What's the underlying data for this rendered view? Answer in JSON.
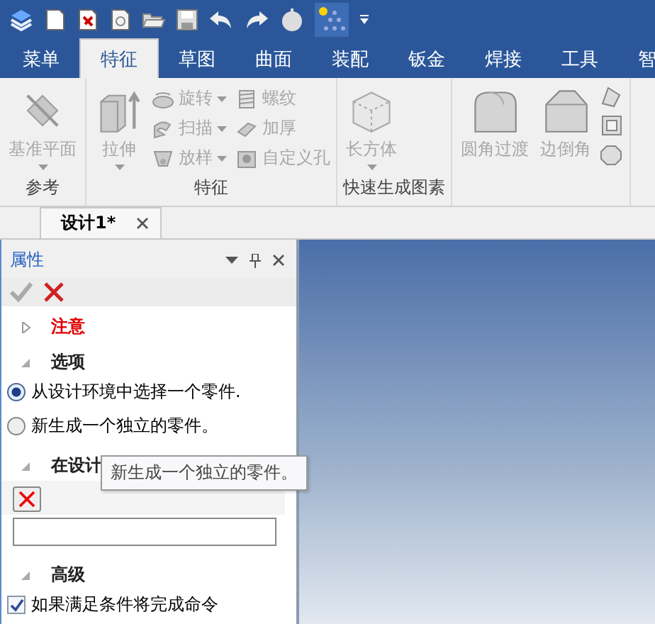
{
  "ribbon": {
    "tabs": [
      {
        "label": "菜单",
        "selected": false
      },
      {
        "label": "特征",
        "selected": true
      },
      {
        "label": "草图",
        "selected": false
      },
      {
        "label": "曲面",
        "selected": false
      },
      {
        "label": "装配",
        "selected": false
      },
      {
        "label": "钣金",
        "selected": false
      },
      {
        "label": "焊接",
        "selected": false
      },
      {
        "label": "工具",
        "selected": false
      },
      {
        "label": "智",
        "selected": false
      }
    ],
    "groups": [
      {
        "label": "参考",
        "large": [
          {
            "label": "基准平面",
            "dropdown": true,
            "disabled": true
          }
        ]
      },
      {
        "label": "特征",
        "large": [
          {
            "label": "拉伸",
            "dropdown": true,
            "disabled": true
          }
        ],
        "small": [
          {
            "label": "旋转",
            "dropdown": true,
            "disabled": true
          },
          {
            "label": "扫描",
            "dropdown": true,
            "disabled": true
          },
          {
            "label": "放样",
            "dropdown": true,
            "disabled": true
          },
          {
            "label": "螺纹",
            "dropdown": false,
            "disabled": true
          },
          {
            "label": "加厚",
            "dropdown": false,
            "disabled": true
          },
          {
            "label": "自定义孔",
            "dropdown": false,
            "disabled": true
          }
        ]
      },
      {
        "label": "快速生成图素",
        "large": [
          {
            "label": "长方体",
            "dropdown": true,
            "disabled": true
          }
        ]
      },
      {
        "large": [
          {
            "label": "圆角过渡",
            "dropdown": false,
            "disabled": true
          },
          {
            "label": "边倒角",
            "dropdown": false,
            "disabled": true
          }
        ]
      }
    ]
  },
  "doc_tabs": [
    {
      "label": "设计1*",
      "selected": true
    }
  ],
  "panel": {
    "title": "属性",
    "sections": [
      {
        "kind": "note",
        "label": "注意",
        "expanded": false
      },
      {
        "kind": "radios",
        "label": "选项",
        "expanded": true,
        "options": [
          {
            "label": "从设计环境中选择一个零件.",
            "selected": true
          },
          {
            "label": "新生成一个独立的零件。",
            "selected": false
          }
        ]
      },
      {
        "kind": "picker",
        "label": "在设计",
        "expanded": true
      },
      {
        "kind": "checkbox",
        "label": "高级",
        "expanded": true,
        "checkbox": {
          "label": "如果满足条件将完成命令",
          "checked": true
        }
      }
    ]
  },
  "tooltip": {
    "text": "新生成一个独立的零件。"
  }
}
